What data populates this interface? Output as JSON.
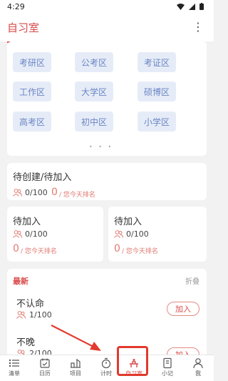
{
  "status": {
    "time": "4:29"
  },
  "app": {
    "title": "自习室",
    "more": "⋮"
  },
  "zones": [
    "考研区",
    "公考区",
    "考证区",
    "工作区",
    "大学区",
    "硕博区",
    "高考区",
    "初中区",
    "小学区"
  ],
  "rank_full": {
    "title": "待创建/待加入",
    "count": "0/100",
    "zero": "0",
    "hint": "/ 您今天排名"
  },
  "rank_left": {
    "title": "待加入",
    "count": "0/100",
    "zero": "0",
    "hint": "/ 您今天排名"
  },
  "rank_right": {
    "title": "待加入",
    "count": "0/100",
    "zero": "0",
    "hint": "/ 您今天排名"
  },
  "latest": {
    "title": "最新",
    "fold": "折叠",
    "rooms": [
      {
        "name": "不认命",
        "count": "1/100",
        "join": "加入"
      },
      {
        "name": "不晚",
        "count": "2/100",
        "join": "加入"
      }
    ]
  },
  "tabs": [
    "清单",
    "日历",
    "项目",
    "计时",
    "自习室",
    "小记",
    "我"
  ],
  "colors": {
    "accent": "#d84a4a",
    "zone_bg": "#e6ecf7",
    "zone_text": "#6a85c6",
    "annotation": "#e23a2e"
  }
}
